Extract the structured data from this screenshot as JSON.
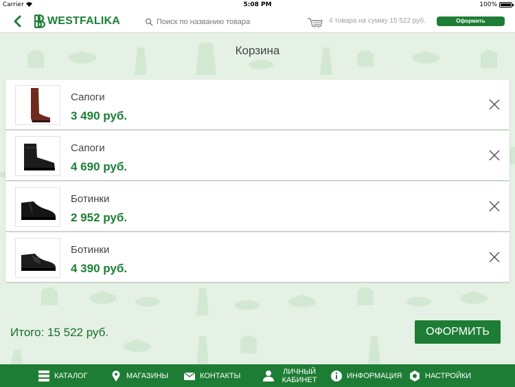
{
  "status_bar": {
    "carrier": "Carrier",
    "time": "5:08 PM",
    "battery": "100%"
  },
  "header": {
    "brand": "WESTFALIKA",
    "search_placeholder": "Поиск по названию товара",
    "cart_summary": "4 товара на сумму 15 522 руб.",
    "checkout_label": "Оформить"
  },
  "page": {
    "title": "Корзина"
  },
  "cart": {
    "items": [
      {
        "name": "Сапоги",
        "price": "3 490 руб.",
        "image": "tall-brown-boot"
      },
      {
        "name": "Сапоги",
        "price": "4 690 руб.",
        "image": "black-ankle-boot"
      },
      {
        "name": "Ботинки",
        "price": "2 952 руб.",
        "image": "black-chelsea-boot"
      },
      {
        "name": "Ботинки",
        "price": "4 390 руб.",
        "image": "black-lace-up-boot"
      }
    ],
    "total": "Итого: 15 522 руб.",
    "checkout_label": "ОФОРМИТЬ"
  },
  "tabbar": {
    "catalog": "КАТАЛОГ",
    "stores": "МАГАЗИНЫ",
    "contacts": "КОНТАКТЫ",
    "account_line1": "ЛИЧНЫЙ",
    "account_line2": "КАБИНЕТ",
    "info": "ИНФОРМАЦИЯ",
    "settings": "НАСТРОЙКИ"
  },
  "colors": {
    "brand_green": "#1e7d34",
    "price_green": "#1a7f33",
    "background": "#e4f1e4"
  }
}
